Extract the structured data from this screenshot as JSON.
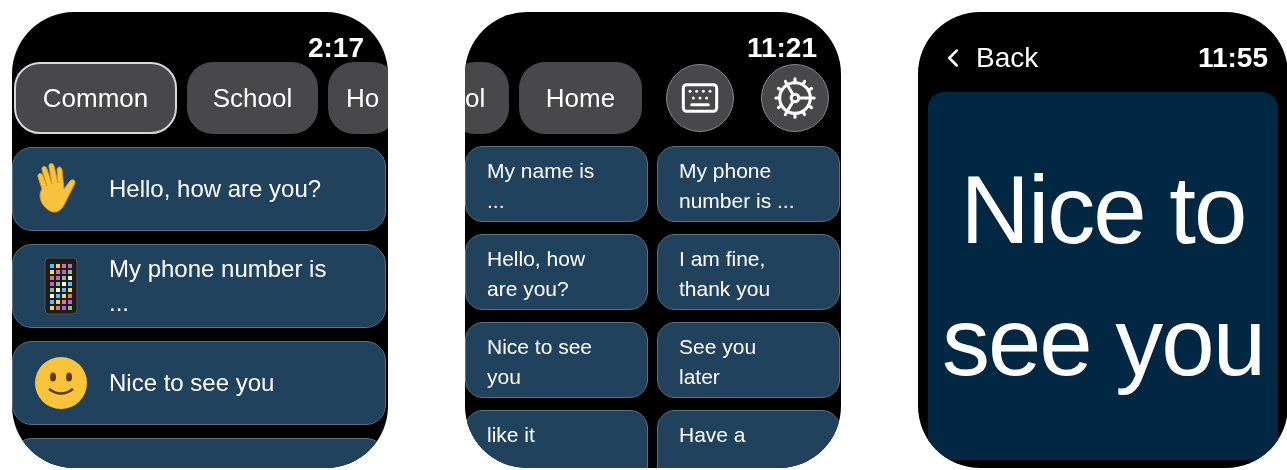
{
  "screens": [
    {
      "kind": "list",
      "time": "2:17",
      "tabs": [
        {
          "label": "Common",
          "selected": true
        },
        {
          "label": "School",
          "selected": false
        },
        {
          "label": "Ho",
          "selected": false
        }
      ],
      "phrases": [
        {
          "kind": "wave",
          "text": "Hello, how are you?"
        },
        {
          "kind": "phone",
          "text": "My phone number is ..."
        },
        {
          "kind": "smile",
          "text": "Nice to see you"
        }
      ]
    },
    {
      "kind": "grid",
      "time": "11:21",
      "tabs": [
        {
          "label": "ol",
          "selected": false
        },
        {
          "label": "Home",
          "selected": false
        }
      ],
      "phrases": [
        {
          "text": "My name is ..."
        },
        {
          "text": "My phone number is ..."
        },
        {
          "text": "Hello, how are you?"
        },
        {
          "text": "I am fine, thank you"
        },
        {
          "text": "Nice to see you"
        },
        {
          "text": "See you later"
        },
        {
          "text": "like it"
        },
        {
          "text": "Have a"
        }
      ]
    },
    {
      "kind": "detail",
      "time": "11:55",
      "back": "Back",
      "text": "Nice to see you"
    }
  ]
}
